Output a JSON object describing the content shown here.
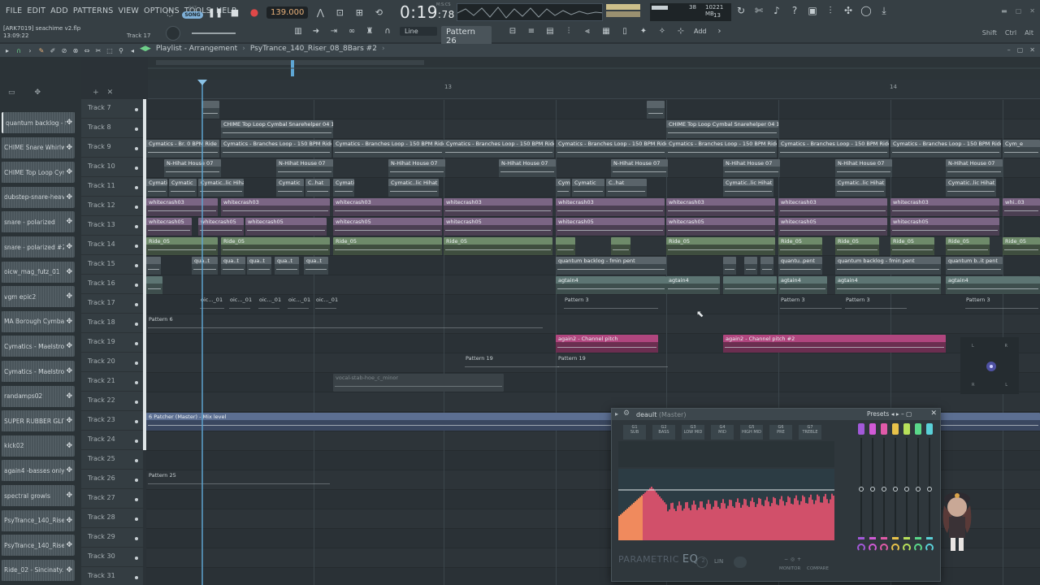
{
  "menu": {
    "items": [
      "FILE",
      "EDIT",
      "ADD",
      "PATTERNS",
      "VIEW",
      "OPTIONS",
      "TOOLS",
      "HELP"
    ]
  },
  "transport": {
    "pat_label": "PAT",
    "song_label": "SONG",
    "tempo": "139.000",
    "time": "0:19",
    "time_sub": ":78",
    "time_unit": "M:S:CS",
    "cpu_voices": "38",
    "memory": "10221 MB",
    "polyphony": "13"
  },
  "project": {
    "file": "[ARK7019] seachime v2.flp",
    "time": "13:09:22",
    "track_hint": "Track 17"
  },
  "toolbar": {
    "snap": "Line",
    "pattern": "Pattern 26",
    "add_label": "Add",
    "shortcuts": [
      "Shift",
      "Ctrl",
      "Alt"
    ]
  },
  "playlist": {
    "breadcrumb": [
      "Playlist - Arrangement",
      "PsyTrance_140_Riser_08_8Bars #2"
    ],
    "ruler": [
      {
        "label": "13"
      },
      {
        "label": "14"
      }
    ]
  },
  "picker": {
    "clips": [
      "quantum backlog - f..",
      "CHIME Snare Whirlwi..",
      "CHIME Top Loop Cym..",
      "dubstep-snare-heav..",
      "snare - polarized",
      "snare - polarized #2",
      "oicw_mag_futz_01",
      "vgm epic2",
      "MA Borough Cymbal..",
      "Cymatics - Maelstro..",
      "Cymatics - Maelstro..",
      "randamps02",
      "SUPER RUBBER GLITCH",
      "kick02",
      "again4 -basses only",
      "spectral growls",
      "PsyTrance_140_Riser..",
      "PsyTrance_140_Riser..",
      "Ride_02 - Sincinaty.."
    ]
  },
  "tracks": [
    "Track 7",
    "Track 8",
    "Track 9",
    "Track 10",
    "Track 11",
    "Track 12",
    "Track 13",
    "Track 14",
    "Track 15",
    "Track 16",
    "Track 17",
    "Track 18",
    "Track 19",
    "Track 20",
    "Track 21",
    "Track 22",
    "Track 23",
    "Track 24",
    "Track 25",
    "Track 26",
    "Track 27",
    "Track 28",
    "Track 29",
    "Track 30",
    "Track 31"
  ],
  "clips": {
    "chime": "CHIME Top Loop Cymbal Snarehelper 04 150",
    "cymatics_short": "Cymatics - Br. 0 BPM Ride",
    "cymatics": "Cymatics - Branches Loop - 150 BPM Ride",
    "cymatics_end": "Cym_e",
    "hihat": "N-Hihat House 07",
    "cym_hihat": "Cymatic..lic Hihat",
    "c_hat": "C..hat",
    "whitecrash03": "whitecrash03",
    "whitecrash05": "whitecrash05",
    "whi": "whi..03",
    "ride": "Ride_05",
    "quantum": "quantum backlog - fmin pent",
    "quantu": "quantu..pent",
    "quantum_b": "quantum b..it pent",
    "agtain4": "agtain4",
    "pattern3": "Pattern 3",
    "pattern6": "Pattern 6",
    "pattern19": "Pattern 19",
    "pattern25": "Pattern 25",
    "again2": "again2 - Channel pitch",
    "again2b": "again2 - Channel pitch #2",
    "vocal": "vocal-stab-hoe_c_minor",
    "patcher": "6 Patcher (Master) - Mix level",
    "qua": "qua..t",
    "oic": "oic..._01",
    "cymatic": "Cymatic"
  },
  "eq": {
    "title": "deault",
    "title_suffix": "(Master)",
    "presets": "Presets",
    "bands": [
      "G1",
      "G2",
      "G3",
      "G4",
      "G5",
      "G6",
      "G7"
    ],
    "band_names": [
      "SUB",
      "BASS",
      "LOW MID",
      "MID",
      "HIGH MID",
      "PRE",
      "TREBLE"
    ],
    "brand": "PARAMETRIC",
    "brand_eq": "EQ",
    "brand_ver": "2",
    "lin": "LIN",
    "monitor": "MONITOR",
    "compare": "COMPARE",
    "slider_colors": [
      "#a259d9",
      "#d05ad6",
      "#e05aa8",
      "#e8c24a",
      "#b8e05a",
      "#5ad88a",
      "#5ad0d8"
    ]
  },
  "scope": {
    "labels": [
      "L",
      "R",
      "R",
      "L"
    ]
  }
}
